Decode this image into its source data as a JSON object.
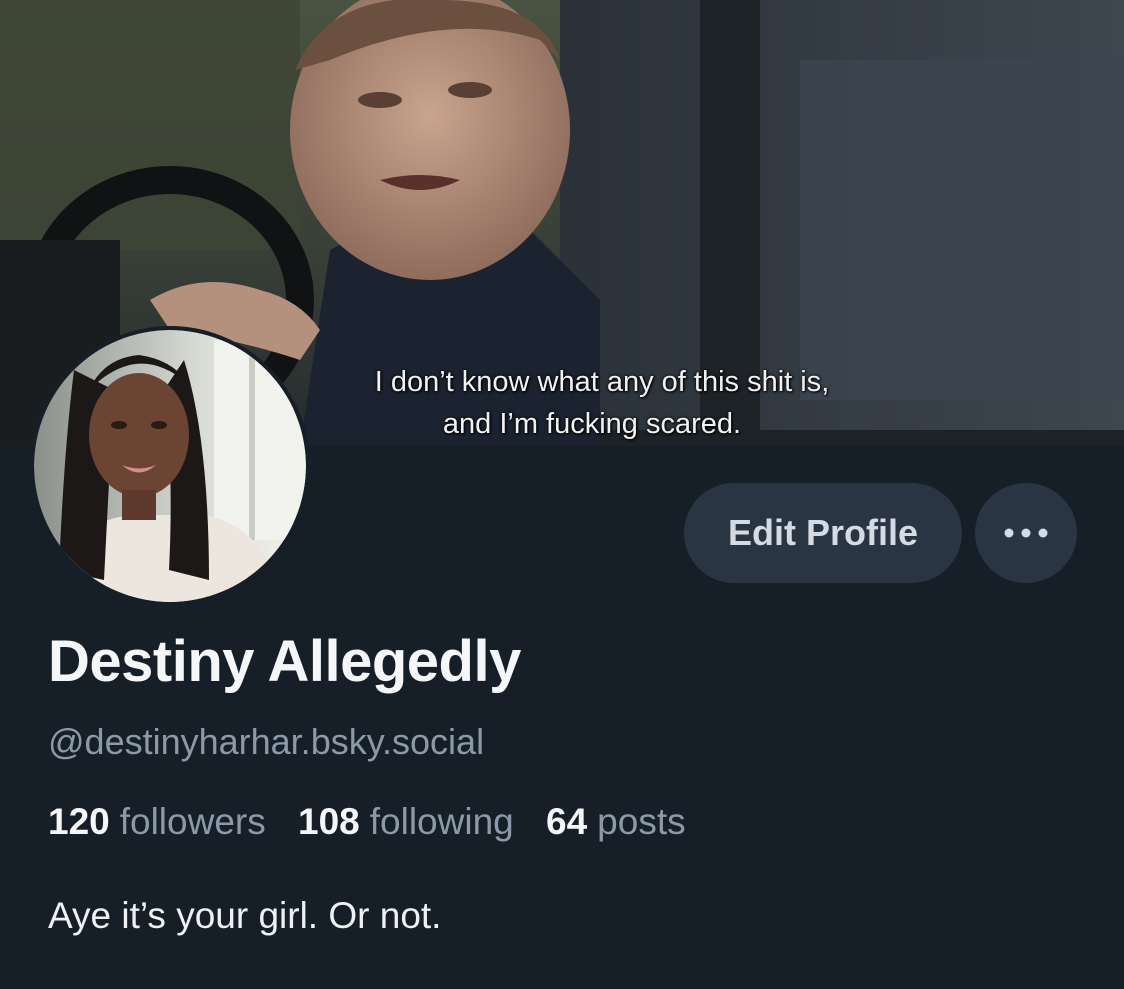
{
  "banner": {
    "subtitle_line1": "I don’t know what any of this shit is,",
    "subtitle_line2": "and I’m fucking scared."
  },
  "profile": {
    "display_name": "Destiny Allegedly",
    "handle": "@destinyharhar.bsky.social",
    "bio": "Aye it’s your girl. Or not."
  },
  "stats": {
    "followers_count": "120",
    "followers_label": "followers",
    "following_count": "108",
    "following_label": "following",
    "posts_count": "64",
    "posts_label": "posts"
  },
  "actions": {
    "edit_profile_label": "Edit Profile",
    "more_icon": "ellipsis-icon"
  },
  "colors": {
    "background": "#161e27",
    "button_bg": "#2a3543",
    "text_primary": "#f4f6f8",
    "text_secondary": "#8c99a9"
  }
}
